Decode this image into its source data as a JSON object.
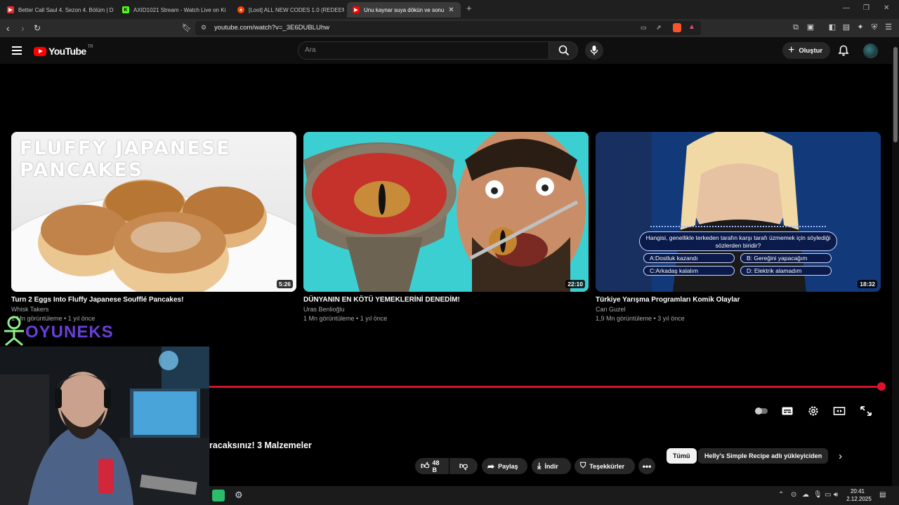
{
  "browser": {
    "tabs": [
      {
        "title": "Better Call Saul 4. Sezon 4. Bölüm | D",
        "favicon": "play-icon",
        "active": false
      },
      {
        "title": "AXID1021 Stream - Watch Live on Ki",
        "favicon": "kick-icon",
        "active": false
      },
      {
        "title": "[Loot] ALL NEW CODES 1.0 (REDEEM",
        "favicon": "reddit-icon",
        "active": false
      },
      {
        "title": "Unu kaynar suya dökün ve sonu",
        "favicon": "youtube-icon",
        "active": true
      }
    ],
    "url": "youtube.com/watch?v=_3E6DUBLUhw"
  },
  "youtube": {
    "logo_text": "YouTube",
    "region": "TR",
    "search_placeholder": "Ara",
    "create_label": "Oluştur"
  },
  "videos": [
    {
      "title": "Turn 2 Eggs Into Fluffy Japanese Soufflé Pancakes!",
      "channel": "Whisk Takers",
      "meta": "1 Mn görüntüleme • 1 yıl önce",
      "duration": "5:26",
      "thumb_text": "FLUFFY JAPANESE PANCAKES"
    },
    {
      "title": "DÜNYANIN EN KÖTÜ YEMEKLERİNİ DENEDİM!",
      "channel": "Uras Benlioğlu",
      "meta": "1 Mn görüntüleme • 1 yıl önce",
      "duration": "22:10"
    },
    {
      "title": "Türkiye Yarışma Programları Komik Olaylar",
      "channel": "Can Guzel",
      "meta": "1,9 Mn görüntüleme • 3 yıl önce",
      "duration": "18:32",
      "quiz": {
        "question": "Hangisi, genellikle terkeden tarafın karşı tarafı üzmemek için söylediği sözlerden biridir?",
        "answers": [
          "A:Dostluk kazandı",
          "B: Gereğini yapacağım",
          "C:Arkadaş kalalım",
          "D: Elektrik alamadım"
        ]
      }
    }
  ],
  "player": {
    "progress": 1.0,
    "title_visible": "racaksınız! 3 Malzemeler"
  },
  "actions": {
    "like_count": "48 B",
    "share": "Paylaş",
    "download": "İndir",
    "thanks": "Teşekkürler"
  },
  "chips": [
    "Tümü",
    "Helly's Simple Recipe adlı yükleyiciden"
  ],
  "overlay": {
    "brand": "OYUNEKS"
  },
  "taskbar": {
    "time": "20:41",
    "date": "2.12.2025"
  },
  "colors": {
    "youtube_red": "#ff0000",
    "progress_red": "#d2122e",
    "oyuneks_purple": "#6a3fd8",
    "oyuneks_green": "#8ef08a"
  }
}
